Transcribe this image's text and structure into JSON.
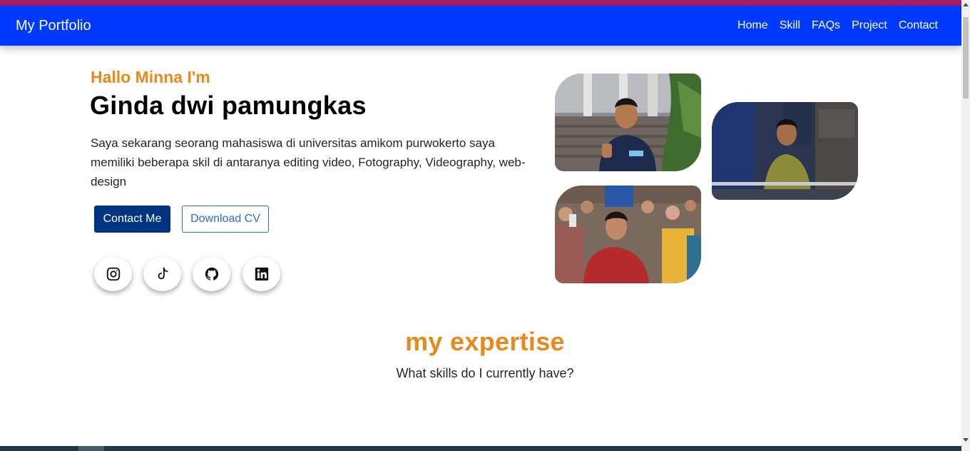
{
  "navbar": {
    "brand": "My Portfolio",
    "links": [
      "Home",
      "Skill",
      "FAQs",
      "Project",
      "Contact"
    ]
  },
  "hero": {
    "greeting": "Hallo Minna I'm",
    "name": "Ginda dwi pamungkas",
    "description": "Saya sekarang seorang mahasiswa di universitas amikom purwokerto saya memiliki beberapa skil di antaranya editing video, Fotography, Videography, web-design",
    "contact_button": "Contact Me",
    "download_button": "Download CV"
  },
  "social_icons": [
    "instagram-icon",
    "tiktok-icon",
    "github-icon",
    "linkedin-icon"
  ],
  "photos": [
    "photo-thumbs-up",
    "photo-railing",
    "photo-red-jacket"
  ],
  "expertise": {
    "title": "my expertise",
    "subtitle": "What skills do I currently have?"
  },
  "colors": {
    "navbar": "#0039ff",
    "top_strip": "#a81c68",
    "accent": "#e8891c",
    "primary_button": "#003380",
    "outline_button": "#2f6ac8",
    "bottom_band": "#213848"
  }
}
